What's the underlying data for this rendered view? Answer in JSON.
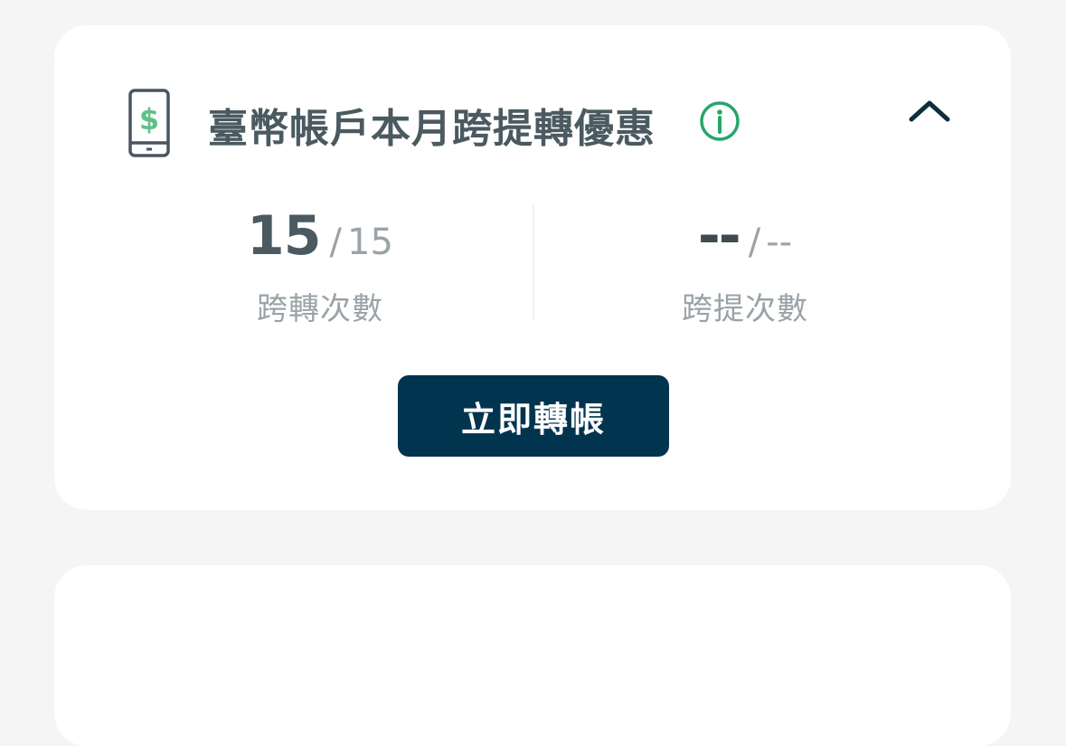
{
  "card": {
    "title": "臺幣帳戶本月跨提轉優惠",
    "icons": {
      "left": "mobile-dollar-icon",
      "info": "info-icon",
      "collapse": "chevron-up-icon"
    },
    "colors": {
      "title": "#4a5a60",
      "accent_green": "#27a66a",
      "button_bg": "#00344f",
      "muted": "#9aa3a7"
    },
    "stats": [
      {
        "used": "15",
        "total": "15",
        "label": "跨轉次數"
      },
      {
        "used": "--",
        "total": "--",
        "label": "跨提次數"
      }
    ],
    "separator": "/",
    "button_label": "立即轉帳"
  }
}
